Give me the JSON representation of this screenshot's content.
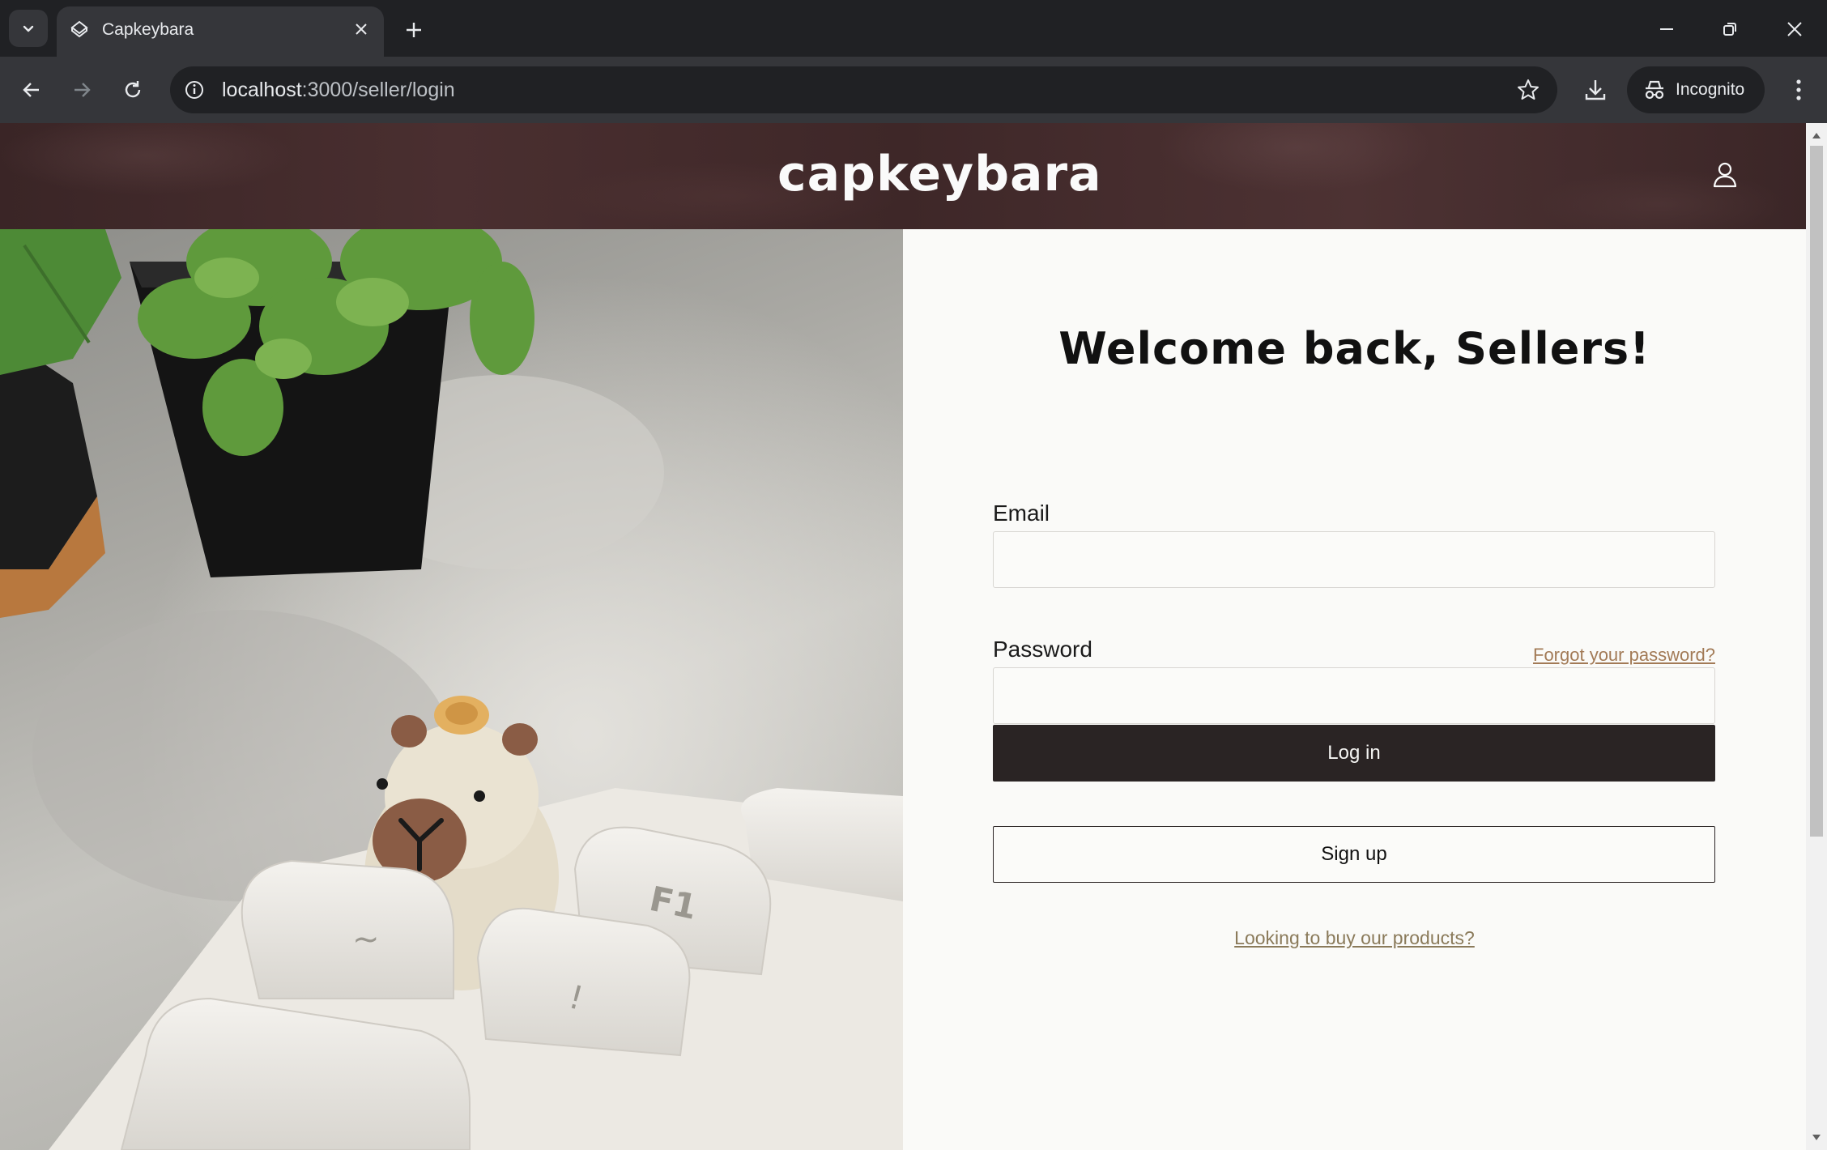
{
  "browser": {
    "tab_title": "Capkeybara",
    "url_host": "localhost",
    "url_path": ":3000/seller/login",
    "incognito_label": "Incognito"
  },
  "site": {
    "brand": "capkeybara"
  },
  "login_form": {
    "title": "Welcome back, Sellers!",
    "email_label": "Email",
    "email_value": "",
    "password_label": "Password",
    "password_value": "",
    "forgot_password": "Forgot your password?",
    "login_button": "Log in",
    "signup_button": "Sign up",
    "buyer_link": "Looking to buy our products?"
  },
  "colors": {
    "header_bg": "#3e2728",
    "primary_button": "#2a2424",
    "link": "#a27a56"
  }
}
